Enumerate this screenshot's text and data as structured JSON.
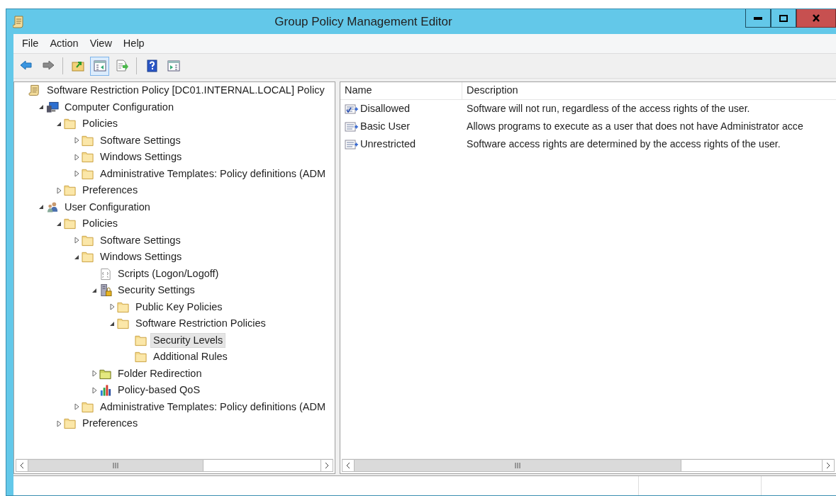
{
  "window": {
    "title": "Group Policy Management Editor"
  },
  "menu": [
    "File",
    "Action",
    "View",
    "Help"
  ],
  "toolbar": [
    {
      "kind": "back",
      "pressed": false
    },
    {
      "kind": "forward",
      "pressed": false
    },
    {
      "kind": "sep"
    },
    {
      "kind": "up",
      "pressed": false
    },
    {
      "kind": "tree",
      "pressed": true
    },
    {
      "kind": "export",
      "pressed": false
    },
    {
      "kind": "sep"
    },
    {
      "kind": "help",
      "pressed": false
    },
    {
      "kind": "action",
      "pressed": false
    }
  ],
  "tree": [
    {
      "label": "Software Restriction Policy [DC01.INTERNAL.LOCAL] Policy",
      "kind": "policy",
      "selected": false,
      "children": [
        {
          "label": "Computer Configuration",
          "kind": "computer",
          "expanded": true,
          "selected": false,
          "children": [
            {
              "label": "Policies",
              "kind": "folder",
              "expanded": true,
              "selected": false,
              "children": [
                {
                  "label": "Software Settings",
                  "kind": "folder",
                  "expanded": false,
                  "selected": false
                },
                {
                  "label": "Windows Settings",
                  "kind": "folder",
                  "expanded": false,
                  "selected": false
                },
                {
                  "label": "Administrative Templates: Policy definitions (ADM",
                  "kind": "folder",
                  "expanded": false,
                  "selected": false
                }
              ]
            },
            {
              "label": "Preferences",
              "kind": "folder",
              "expanded": false,
              "selected": false
            }
          ]
        },
        {
          "label": "User Configuration",
          "kind": "users",
          "expanded": true,
          "selected": false,
          "children": [
            {
              "label": "Policies",
              "kind": "folder",
              "expanded": true,
              "selected": false,
              "children": [
                {
                  "label": "Software Settings",
                  "kind": "folder",
                  "expanded": false,
                  "selected": false
                },
                {
                  "label": "Windows Settings",
                  "kind": "folder",
                  "expanded": true,
                  "selected": false,
                  "children": [
                    {
                      "label": "Scripts (Logon/Logoff)",
                      "kind": "script",
                      "selected": false
                    },
                    {
                      "label": "Security Settings",
                      "kind": "security",
                      "expanded": true,
                      "selected": false,
                      "children": [
                        {
                          "label": "Public Key Policies",
                          "kind": "folder",
                          "expanded": false,
                          "selected": false
                        },
                        {
                          "label": "Software Restriction Policies",
                          "kind": "folder",
                          "expanded": true,
                          "selected": false,
                          "children": [
                            {
                              "label": "Security Levels",
                              "kind": "folder",
                              "selected": true
                            },
                            {
                              "label": "Additional Rules",
                              "kind": "folder",
                              "selected": false
                            }
                          ]
                        }
                      ]
                    },
                    {
                      "label": "Folder Redirection",
                      "kind": "redirect",
                      "expanded": false,
                      "selected": false
                    },
                    {
                      "label": "Policy-based QoS",
                      "kind": "qos",
                      "expanded": false,
                      "selected": false
                    }
                  ]
                },
                {
                  "label": "Administrative Templates: Policy definitions (ADM",
                  "kind": "folder",
                  "expanded": false,
                  "selected": false
                }
              ]
            },
            {
              "label": "Preferences",
              "kind": "folder",
              "expanded": false,
              "selected": false
            }
          ]
        }
      ]
    }
  ],
  "list": {
    "columns": [
      "Name",
      "Description"
    ],
    "rows": [
      {
        "name": "Disallowed",
        "description": "Software will not run, regardless of the access rights of the user.",
        "default": true
      },
      {
        "name": "Basic User",
        "description": "Allows programs to execute as a user that does not have Administrator acce",
        "default": false
      },
      {
        "name": "Unrestricted",
        "description": "Software access rights are determined by the access rights of the user.",
        "default": false
      }
    ]
  }
}
